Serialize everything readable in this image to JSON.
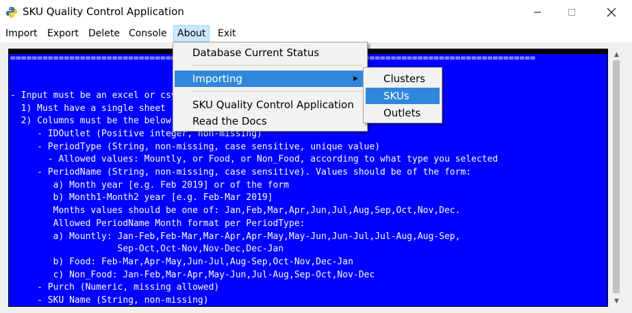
{
  "window": {
    "title": "SKU Quality Control Application",
    "icon": "python-icon",
    "controls": [
      "minimize-icon",
      "maximize-icon",
      "close-icon"
    ]
  },
  "menubar": {
    "items": [
      {
        "label": "Import"
      },
      {
        "label": "Export"
      },
      {
        "label": "Delete"
      },
      {
        "label": "Console"
      },
      {
        "label": "About",
        "active": true
      },
      {
        "label": "Exit"
      }
    ]
  },
  "about_menu": {
    "items": [
      {
        "label": "Database Current Status"
      },
      {
        "label": "Importing",
        "has_submenu": true,
        "highlighted": true
      },
      {
        "label": "SKU Quality Control Application"
      },
      {
        "label": "Read the Docs"
      }
    ],
    "submenu": {
      "items": [
        {
          "label": "Clusters"
        },
        {
          "label": "SKUs",
          "highlighted": true
        },
        {
          "label": "Outlets"
        }
      ]
    }
  },
  "console": {
    "background": "#0000ff",
    "text_color": "#ffffff",
    "lines": [
      "==================================================================================================",
      "",
      "",
      "- Input must be an excel or csv file with data in the following format:",
      "  1) Must have a single sheet",
      "  2) Columns must be the below",
      "     - IDOutlet (Positive integer, non-missing)",
      "     - PeriodType (String, non-missing, case sensitive, unique value)",
      "       - Allowed values: Mountly, or Food, or Non_Food, according to what type you selected",
      "     - PeriodName (String, non-missing, case sensitive). Values should be of the form:",
      "        a) Month year [e.g. Feb 2019] or of the form",
      "        b) Month1-Month2 year [e.g. Feb-Mar 2019]",
      "        Months values should be one of: Jan,Feb,Mar,Apr,Jun,Jul,Aug,Sep,Oct,Nov,Dec.",
      "        Allowed PeriodName Month format per PeriodType:",
      "        a) Mountly: Jan-Feb,Feb-Mar,Mar-Apr,Apr-May,May-Jun,Jun-Jul,Jul-Aug,Aug-Sep,",
      "                    Sep-Oct,Oct-Nov,Nov-Dec,Dec-Jan",
      "        b) Food: Feb-Mar,Apr-May,Jun-Jul,Aug-Sep,Oct-Nov,Dec-Jan",
      "        c) Non_Food: Jan-Feb,Mar-Apr,May-Jun,Jul-Aug,Sep-Oct,Nov-Dec",
      "     - Purch (Numeric, missing allowed)",
      "     - SKU Name (String, non-missing)"
    ]
  }
}
